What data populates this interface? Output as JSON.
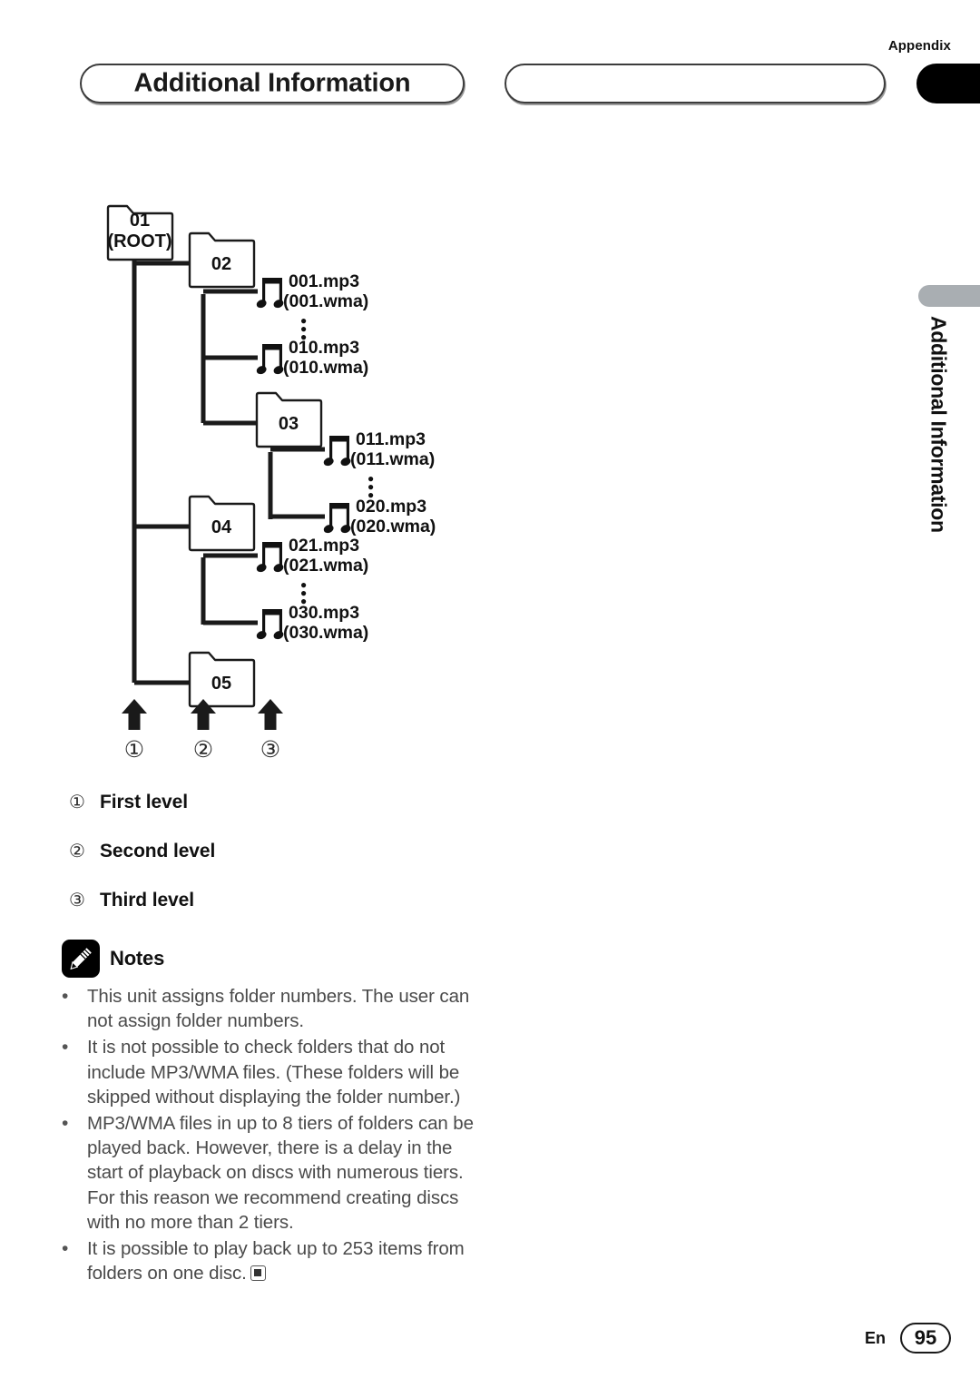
{
  "header": {
    "appendix_label": "Appendix",
    "title": "Additional Information",
    "blank_pill_label": "",
    "black_tab_icon": "page-edge-tab-icon"
  },
  "side_tab": {
    "vertical_label": "Additional Information",
    "gray_bar_color": "#a9aeb2"
  },
  "diagram": {
    "type": "folder-hierarchy-tree",
    "folders": [
      {
        "id": "01",
        "label_line1": "01",
        "label_line2": "(ROOT)",
        "level": 1
      },
      {
        "id": "02",
        "label_line1": "02",
        "label_line2": "",
        "level": 2
      },
      {
        "id": "03",
        "label_line1": "03",
        "label_line2": "",
        "level": 3
      },
      {
        "id": "04",
        "label_line1": "04",
        "label_line2": "",
        "level": 2
      },
      {
        "id": "05",
        "label_line1": "05",
        "label_line2": "",
        "level": 2
      }
    ],
    "files": [
      {
        "parent": "02",
        "mp3": "001.mp3",
        "wma": "(001.wma)"
      },
      {
        "parent": "02",
        "mp3": "010.mp3",
        "wma": "(010.wma)"
      },
      {
        "parent": "03",
        "mp3": "011.mp3",
        "wma": "(011.wma)"
      },
      {
        "parent": "03",
        "mp3": "020.mp3",
        "wma": "(020.wma)"
      },
      {
        "parent": "04",
        "mp3": "021.mp3",
        "wma": "(021.wma)"
      },
      {
        "parent": "04",
        "mp3": "030.mp3",
        "wma": "(030.wma)"
      }
    ],
    "ellipsis_marker": "vertical-dots",
    "file_icon": "music-note-icon",
    "folder_icon": "folder-icon",
    "arrows": [
      {
        "number": "1",
        "circled": "①"
      },
      {
        "number": "2",
        "circled": "②"
      },
      {
        "number": "3",
        "circled": "③"
      }
    ]
  },
  "levels": [
    {
      "marker": "①",
      "label": "First level"
    },
    {
      "marker": "②",
      "label": "Second level"
    },
    {
      "marker": "③",
      "label": "Third level"
    }
  ],
  "notes": {
    "icon": "pencil-icon",
    "title": "Notes",
    "bullet": "•",
    "items": [
      "This unit assigns folder numbers. The user can not assign folder numbers.",
      "It is not possible to check folders that do not include MP3/WMA files. (These folders will be skipped without displaying the folder number.)",
      "MP3/WMA files in up to 8 tiers of folders can be played back. However, there is a delay in the start of playback on discs with numerous tiers. For this reason we recommend creating discs with no more than 2 tiers.",
      "It is possible to play back up to 253 items from folders on one disc."
    ],
    "end_of_section_marker": "filled-square-icon"
  },
  "footer": {
    "language": "En",
    "page_number": "95"
  }
}
